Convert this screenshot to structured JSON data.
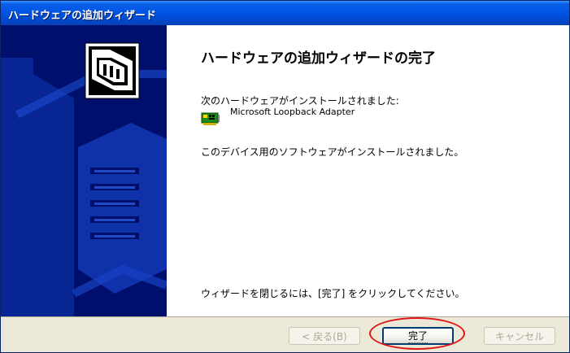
{
  "window": {
    "title": "ハードウェアの追加ウィザード"
  },
  "content": {
    "heading": "ハードウェアの追加ウィザードの完了",
    "installed_intro": "次のハードウェアがインストールされました:",
    "device_name": "Microsoft Loopback Adapter",
    "software_installed": "このデバイス用のソフトウェアがインストールされました。",
    "close_instruction": "ウィザードを閉じるには、[完了] をクリックしてください。"
  },
  "buttons": {
    "back": "< 戻る(B)",
    "finish": "完了",
    "cancel": "キャンセル"
  },
  "colors": {
    "titlebar": "#0054e3",
    "sidepanel": "#000f6b",
    "highlight_circle": "#e01414"
  },
  "icons": {
    "wizard": "hardware-box-icon",
    "device": "network-adapter-icon"
  }
}
